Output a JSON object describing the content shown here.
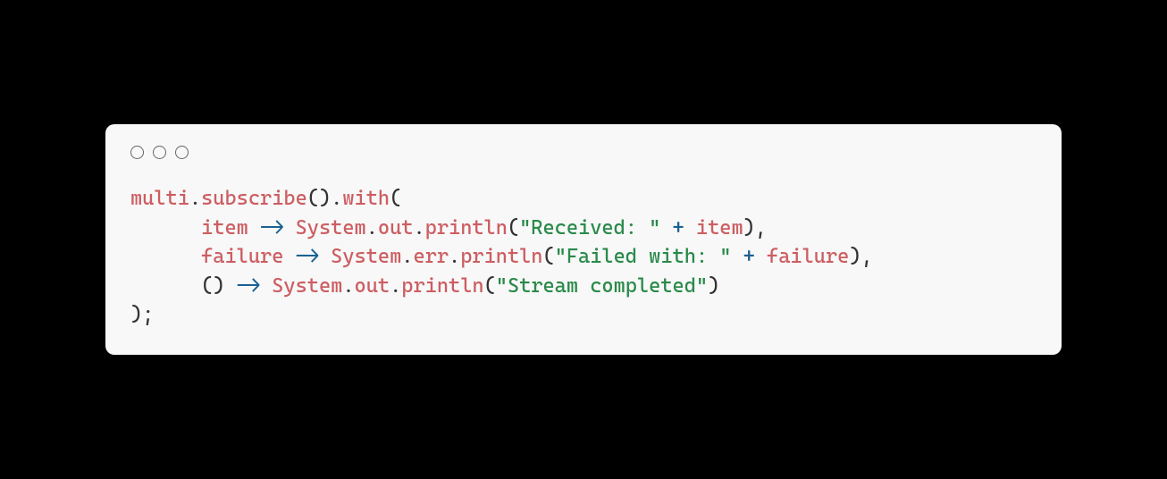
{
  "code": {
    "line1": {
      "t1": "multi",
      "t2": ".",
      "t3": "subscribe",
      "t4": "().",
      "t5": "with",
      "t6": "("
    },
    "line2": {
      "indent": "      ",
      "t1": "item",
      "t2": " ",
      "t3": "->",
      "t4": " ",
      "t5": "System",
      "t6": ".",
      "t7": "out",
      "t8": ".",
      "t9": "println",
      "t10": "(",
      "t11": "\"Received: \"",
      "t12": " ",
      "t13": "+",
      "t14": " ",
      "t15": "item",
      "t16": "),"
    },
    "line3": {
      "indent": "      ",
      "t1": "failure",
      "t2": " ",
      "t3": "->",
      "t4": " ",
      "t5": "System",
      "t6": ".",
      "t7": "err",
      "t8": ".",
      "t9": "println",
      "t10": "(",
      "t11": "\"Failed with: \"",
      "t12": " ",
      "t13": "+",
      "t14": " ",
      "t15": "failure",
      "t16": "),"
    },
    "line4": {
      "indent": "      ",
      "t1": "()",
      "t2": " ",
      "t3": "->",
      "t4": " ",
      "t5": "System",
      "t6": ".",
      "t7": "out",
      "t8": ".",
      "t9": "println",
      "t10": "(",
      "t11": "\"Stream completed\"",
      "t12": ")"
    },
    "line5": {
      "t1": ");"
    }
  }
}
